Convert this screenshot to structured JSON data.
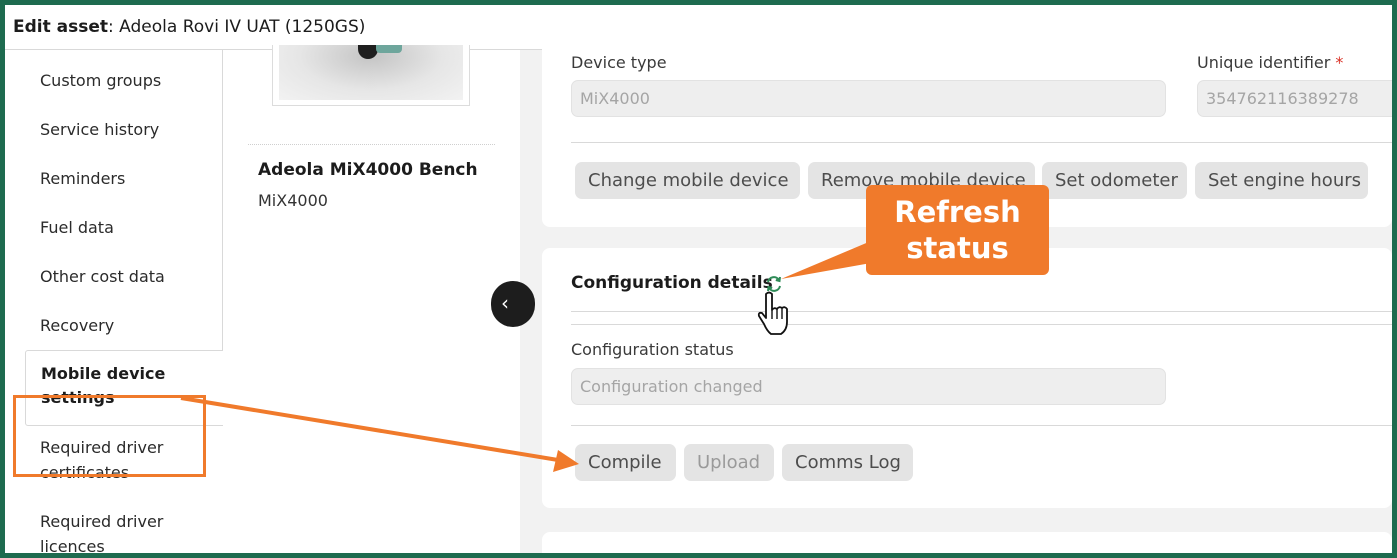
{
  "title": {
    "prefix": "Edit asset",
    "asset": ": Adeola Rovi IV UAT (1250GS)"
  },
  "sidebar": {
    "items": [
      {
        "label": "Custom groups"
      },
      {
        "label": "Service history"
      },
      {
        "label": "Reminders"
      },
      {
        "label": "Fuel data"
      },
      {
        "label": "Other cost data"
      },
      {
        "label": "Recovery"
      },
      {
        "label": "Mobile device settings",
        "active": true
      },
      {
        "label": "Required driver certificates"
      },
      {
        "label": "Required driver licences"
      }
    ]
  },
  "asset": {
    "name": "Adeola MiX4000 Bench",
    "model": "MiX4000"
  },
  "device": {
    "type_label": "Device type",
    "type_value": "MiX4000",
    "uid_label": "Unique identifier",
    "uid_required": "*",
    "uid_value": "354762116389278",
    "buttons": {
      "change": "Change mobile device",
      "remove": "Remove mobile device",
      "odometer": "Set odometer",
      "engine": "Set engine hours"
    }
  },
  "configuration": {
    "title": "Configuration details",
    "status_label": "Configuration status",
    "status_value": "Configuration changed",
    "buttons": {
      "compile": "Compile",
      "upload": "Upload",
      "comms": "Comms Log"
    }
  },
  "annotation": {
    "callout_line1": "Refresh",
    "callout_line2": "status",
    "color": "#f07a2b"
  },
  "icons": {
    "refresh": "refresh-icon",
    "cursor": "hand-cursor-icon",
    "collapse": "chevron-left-icon"
  },
  "colors": {
    "frame": "#1e6b4f",
    "refresh_icon": "#2e8b57"
  }
}
